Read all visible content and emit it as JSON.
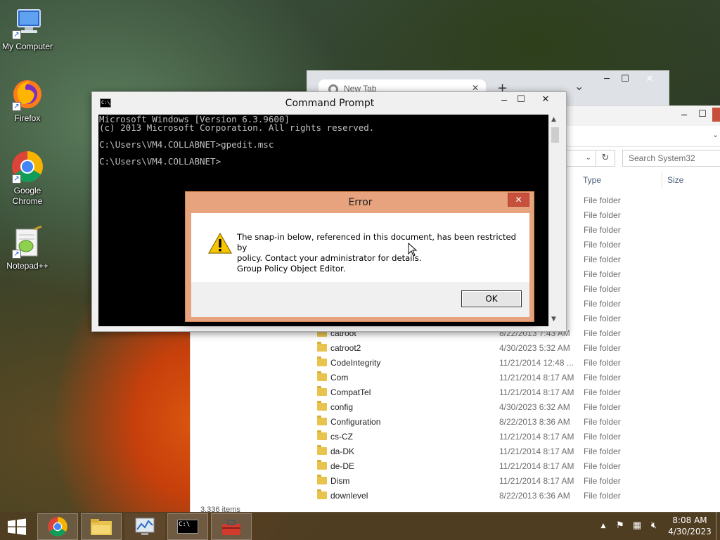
{
  "desktop": {
    "icons": [
      {
        "label": "My Computer"
      },
      {
        "label": "Firefox"
      },
      {
        "label": "Google Chrome"
      },
      {
        "label": "Notepad++"
      }
    ]
  },
  "chrome": {
    "tab_title": "New Tab",
    "new_tab": "+",
    "tab_list": "⌄",
    "min": "─",
    "max": "☐",
    "close": "✕"
  },
  "explorer": {
    "search_placeholder": "Search System32",
    "refresh": "↻",
    "min": "─",
    "max": "☐",
    "columns": {
      "type": "Type",
      "size": "Size"
    },
    "partial_type_rows": [
      "File folder",
      "File folder",
      "File folder",
      "File folder",
      "File folder",
      "File folder",
      "File folder",
      "File folder",
      "File folder"
    ],
    "rows": [
      {
        "name": "catroot",
        "date": "8/22/2013 7:43 AM",
        "type": "File folder"
      },
      {
        "name": "catroot2",
        "date": "4/30/2023 5:32 AM",
        "type": "File folder"
      },
      {
        "name": "CodeIntegrity",
        "date": "11/21/2014 12:48 ...",
        "type": "File folder"
      },
      {
        "name": "Com",
        "date": "11/21/2014 8:17 AM",
        "type": "File folder"
      },
      {
        "name": "CompatTel",
        "date": "11/21/2014 8:17 AM",
        "type": "File folder"
      },
      {
        "name": "config",
        "date": "4/30/2023 6:32 AM",
        "type": "File folder"
      },
      {
        "name": "Configuration",
        "date": "8/22/2013 8:36 AM",
        "type": "File folder"
      },
      {
        "name": "cs-CZ",
        "date": "11/21/2014 8:17 AM",
        "type": "File folder"
      },
      {
        "name": "da-DK",
        "date": "11/21/2014 8:17 AM",
        "type": "File folder"
      },
      {
        "name": "de-DE",
        "date": "11/21/2014 8:17 AM",
        "type": "File folder"
      },
      {
        "name": "Dism",
        "date": "11/21/2014 8:17 AM",
        "type": "File folder"
      },
      {
        "name": "downlevel",
        "date": "8/22/2013 6:36 AM",
        "type": "File folder"
      }
    ],
    "status": "3,336 items"
  },
  "cmd": {
    "title": "Command Prompt",
    "icon_text": "C:\\",
    "console_lines": [
      "Microsoft Windows [Version 6.3.9600]",
      "(c) 2013 Microsoft Corporation. All rights reserved.",
      "",
      "C:\\Users\\VM4.COLLABNET>gpedit.msc",
      "",
      "C:\\Users\\VM4.COLLABNET>"
    ],
    "min": "─",
    "max": "☐",
    "close": "✕"
  },
  "error_dialog": {
    "title": "Error",
    "message_line1": "The snap-in below, referenced in this document, has been restricted by",
    "message_line2": "policy. Contact your administrator for details.",
    "message_line3": "Group Policy Object Editor.",
    "ok": "OK",
    "close": "✕"
  },
  "taskbar": {
    "time": "8:08 AM",
    "date": "4/30/2023",
    "tray_arrow": "▲"
  },
  "colors": {
    "taskbar": "#503e23",
    "error_frame": "#e7a37e",
    "close_red": "#c7503c"
  }
}
